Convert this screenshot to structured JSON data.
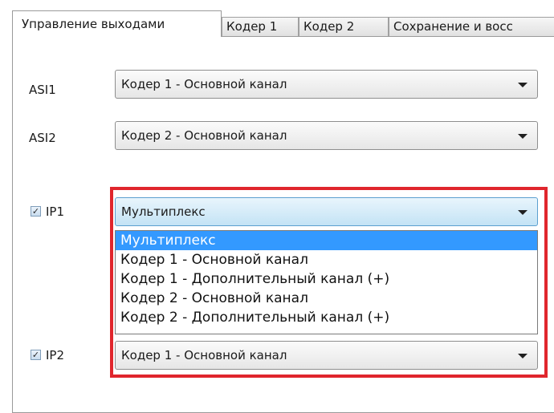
{
  "tabs": [
    {
      "label": "Управление выходами"
    },
    {
      "label": "Кодер 1"
    },
    {
      "label": "Кодер 2"
    },
    {
      "label": "Сохранение и восс"
    }
  ],
  "rows": {
    "asi1": {
      "label": "ASI1",
      "value": "Кодер 1 - Основной канал"
    },
    "asi2": {
      "label": "ASI2",
      "value": "Кодер 2 - Основной канал"
    },
    "ip1": {
      "label": "IP1",
      "checked": true,
      "value": "Мультиплекс"
    },
    "ip2": {
      "label": "IP2",
      "checked": true,
      "value": "Кодер 1 - Основной канал"
    }
  },
  "dropdown": {
    "options": [
      "Мультиплекс",
      "Кодер 1 - Основной канал",
      "Кодер 1 - Дополнительный канал (+)",
      "Кодер 2 - Основной канал",
      "Кодер 2 - Дополнительный канал (+)"
    ],
    "selected_index": 0
  },
  "colors": {
    "highlight": "#e0262d",
    "selection": "#3399ff"
  },
  "icons": {
    "combo_arrow": "chevron-down-icon",
    "check": "checkmark-icon"
  }
}
